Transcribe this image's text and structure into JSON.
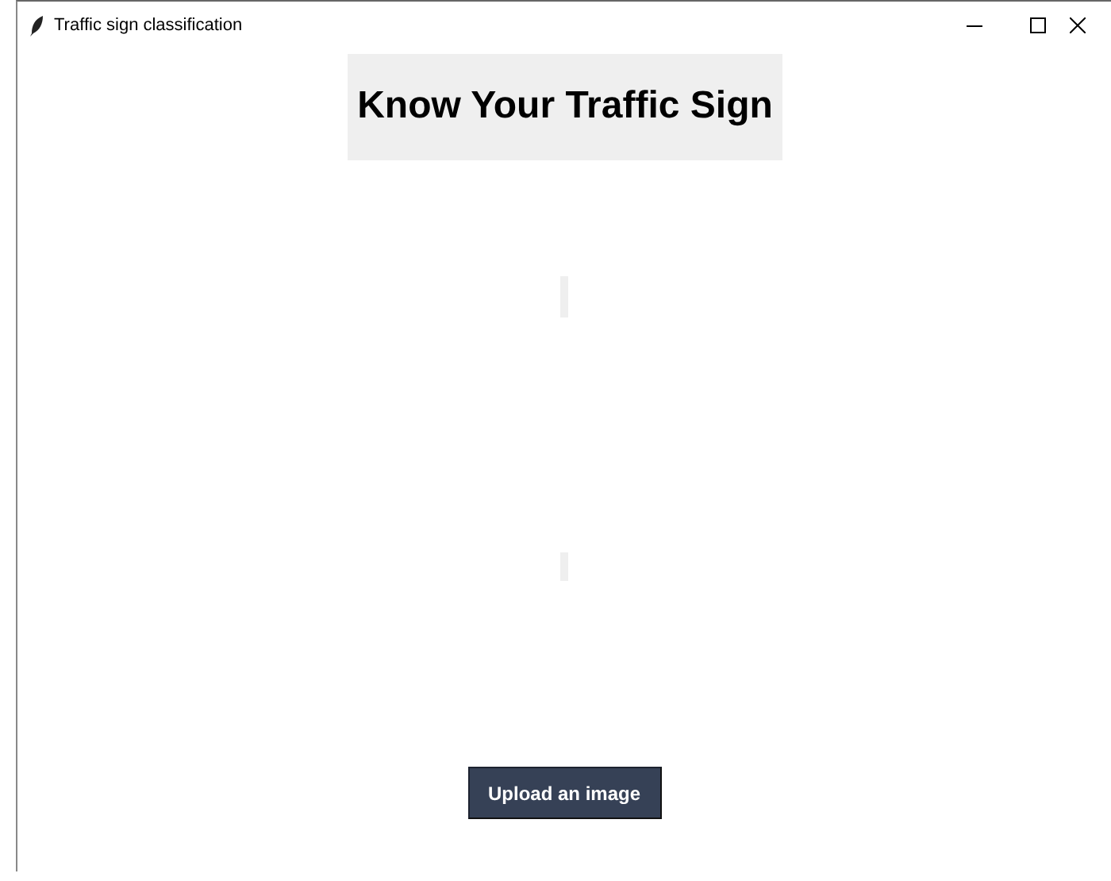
{
  "window": {
    "title": "Traffic sign classification"
  },
  "heading": "Know Your Traffic Sign",
  "upload_button": "Upload an image"
}
